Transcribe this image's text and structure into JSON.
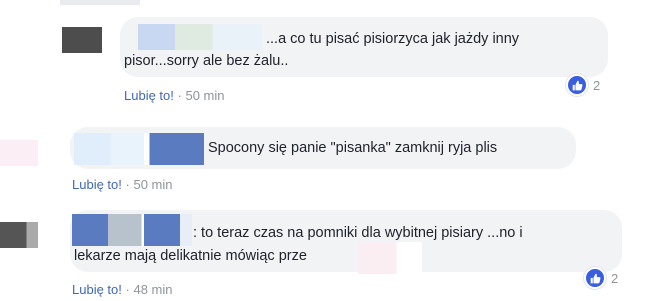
{
  "comments": [
    {
      "line1": "...a co tu pisać pisiorzyca jak jażdy inny",
      "line2": "pisor...sorry ale bez żalu..",
      "like_label": "Lubię to!",
      "separator": "·",
      "time": "50 min",
      "reaction_icon": "thumbs-up-icon",
      "reaction_count": "2"
    },
    {
      "line1": "Spocony się panie \"pisanka\" zamknij ryja plis",
      "like_label": "Lubię to!",
      "separator": "·",
      "time": "50 min"
    },
    {
      "line1": ": to teraz czas na pomniki dla wybitnej pisiary ...no i",
      "line2": "lekarze mają delikatnie mówiąc prze",
      "like_label": "Lubię to!",
      "separator": "·",
      "time": "48 min",
      "reaction_icon": "thumbs-up-icon",
      "reaction_count": "2"
    }
  ],
  "colors": {
    "bubble": "#f2f3f5",
    "link": "#4267b2",
    "meta": "#90949c",
    "reaction": "#3b5ee0"
  }
}
